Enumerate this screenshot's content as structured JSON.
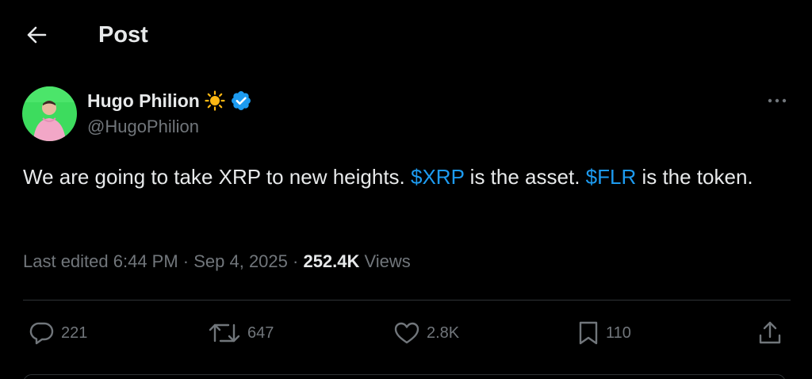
{
  "header": {
    "back_icon": "arrow-left-icon",
    "title": "Post"
  },
  "author": {
    "name": "Hugo Philion",
    "emoji_icon": "sun-emoji-icon",
    "verified_icon": "verified-badge-icon",
    "handle": "@HugoPhilion",
    "more_icon": "more-horizontal-icon"
  },
  "tweet": {
    "text_part1": "We are going to take XRP to new heights. ",
    "cashtag1": "$XRP",
    "text_part2": " is the asset. ",
    "cashtag2": "$FLR",
    "text_part3": " is the token."
  },
  "meta": {
    "edited": "Last edited 6:44 PM · Sep 4, 2025 · ",
    "views_count": "252.4K",
    "views_label": " Views"
  },
  "actions": {
    "replies": "221",
    "reposts": "647",
    "likes": "2.8K",
    "bookmarks": "110"
  },
  "colors": {
    "background": "#000000",
    "text": "#e7e9ea",
    "secondary": "#71767b",
    "accent": "#1d9bf0",
    "divider": "#2f3336",
    "avatar_bg": "#2ecc71"
  }
}
